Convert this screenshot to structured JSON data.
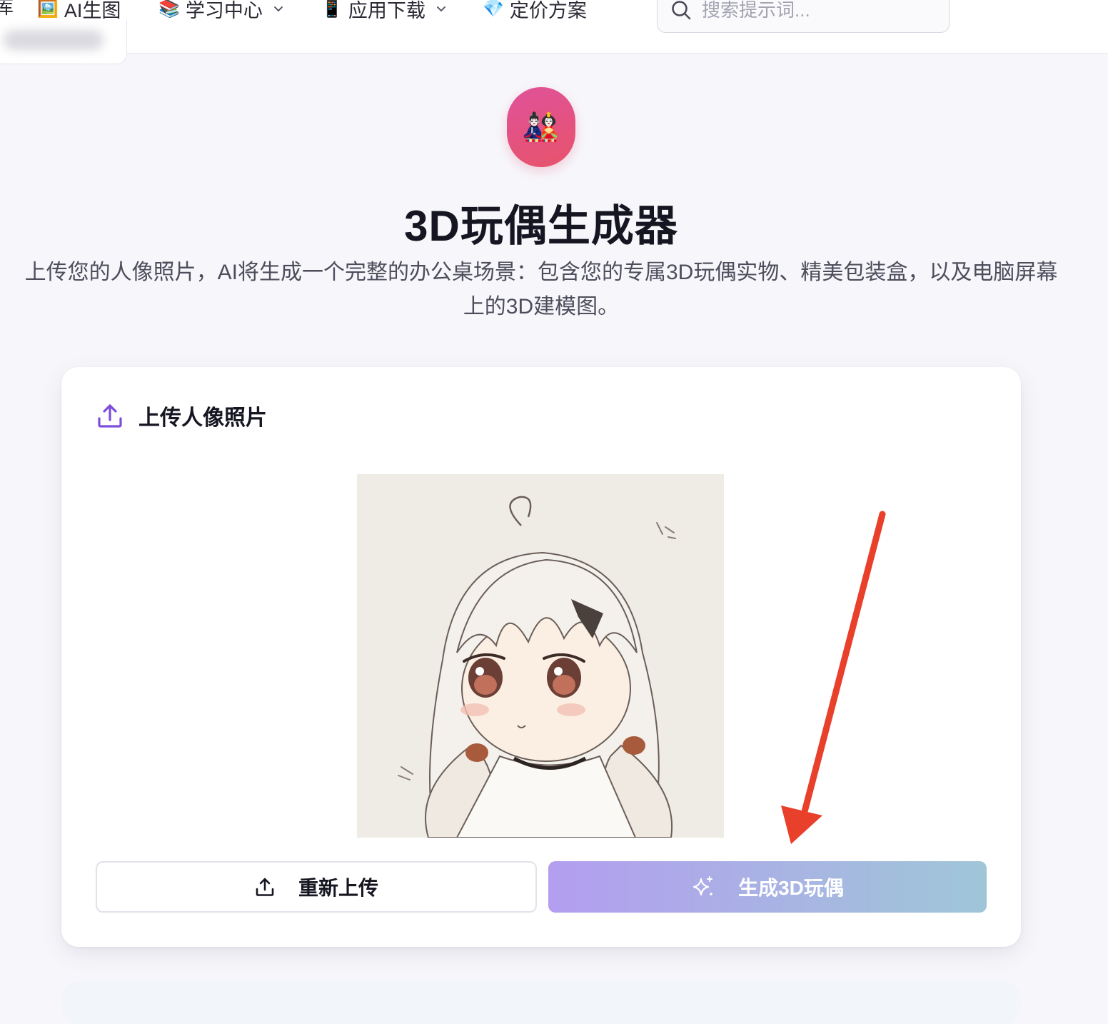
{
  "nav": {
    "edge_text": "库",
    "items": [
      {
        "emoji": "🖼️",
        "label": "AI生图",
        "dropdown": false
      },
      {
        "emoji": "📚",
        "label": "学习中心",
        "dropdown": true
      },
      {
        "emoji": "📱",
        "label": "应用下载",
        "dropdown": true
      },
      {
        "emoji": "💎",
        "label": "定价方案",
        "dropdown": false
      }
    ],
    "search_placeholder": "搜索提示词..."
  },
  "hero": {
    "icon_emoji": "🎎",
    "title": "3D玩偶生成器",
    "description": "上传您的人像照片，AI将生成一个完整的办公桌场景：包含您的专属3D玩偶实物、精美包装盒，以及电脑屏幕上的3D建模图。"
  },
  "upload_card": {
    "title": "上传人像照片",
    "reupload_label": "重新上传",
    "generate_label": "生成3D玩偶"
  },
  "colors": {
    "accent_purple": "#7c4ddc",
    "generate_gradient_start": "#b39ef0",
    "generate_gradient_end": "#9fc6d8",
    "annotation_arrow": "#e8402a",
    "hero_icon_bg": "#e0529a"
  }
}
